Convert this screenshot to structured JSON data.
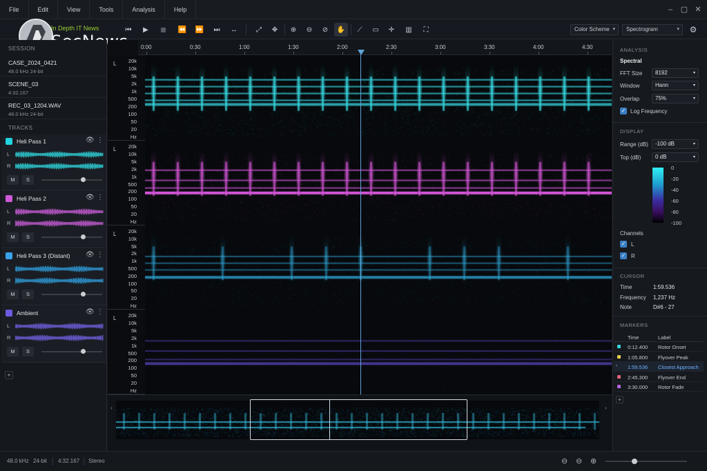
{
  "menu": [
    "File",
    "Edit",
    "View",
    "Tools",
    "Analysis",
    "Help"
  ],
  "logo_text": "SecNews",
  "logo_tagline": "In Depth IT News",
  "toolbar": {
    "color_scheme": "Color Scheme",
    "view_mode": "Spectrogram"
  },
  "session": {
    "header": "SESSION",
    "items": [
      {
        "title": "CASE_2024_0421",
        "sub": "48.0 kHz  24-bit"
      },
      {
        "title": "SCENE_03",
        "sub": "4:32.167"
      },
      {
        "title": "REC_03_1204.WAV",
        "sub": "48.0 kHz  24-bit"
      }
    ]
  },
  "tracks": {
    "header": "TRACKS",
    "items": [
      {
        "name": "Heli Pass 1",
        "color": "#22d3e0",
        "wave": "#2fd0d8",
        "l": "L",
        "r": "R",
        "m": "M",
        "s": "S",
        "level": 0.68
      },
      {
        "name": "Heli Pass 2",
        "color": "#d058d8",
        "wave": "#c45ad2",
        "l": "L",
        "r": "R",
        "m": "M",
        "s": "S",
        "level": 0.68
      },
      {
        "name": "Heli Pass 3 (Distant)",
        "color": "#3aa3e8",
        "wave": "#2f9ad8",
        "l": "L",
        "r": "R",
        "m": "M",
        "s": "S",
        "level": 0.68
      },
      {
        "name": "Ambient",
        "color": "#6a5ce0",
        "wave": "#6d5fdc",
        "l": "L",
        "r": "R",
        "m": "M",
        "s": "S",
        "level": 0.68
      }
    ],
    "add": "+"
  },
  "ruler": [
    "0:00",
    "0:30",
    "1:00",
    "1:30",
    "2:00",
    "2:30",
    "3:00",
    "3:30",
    "4:00",
    "4:30"
  ],
  "freq_labels": [
    "20k",
    "10k",
    "5k",
    "2k",
    "1k",
    "500",
    "200",
    "100",
    "50",
    "20",
    "Hz"
  ],
  "lanes": [
    {
      "channel": "L",
      "color": "#39e3ec",
      "bands": [
        0.28,
        0.36,
        0.44,
        0.52,
        0.56
      ],
      "pulses": true,
      "strength": 1.0
    },
    {
      "channel": "L",
      "color": "#e25be6",
      "bands": [
        0.34,
        0.46,
        0.55,
        0.6
      ],
      "pulses": true,
      "strength": 0.9
    },
    {
      "channel": "L",
      "color": "#34b8ee",
      "bands": [
        0.36,
        0.44,
        0.52,
        0.6
      ],
      "pulses": true,
      "strength": 0.6
    },
    {
      "channel": "L",
      "color": "#6a56e6",
      "bands": [
        0.36,
        0.48,
        0.58,
        0.62
      ],
      "pulses": false,
      "strength": 0.5
    }
  ],
  "analysis": {
    "header": "ANALYSIS",
    "mode": "Spectral",
    "fft_label": "FFT Size",
    "fft_value": "8192",
    "window_label": "Window",
    "window_value": "Hann",
    "overlap_label": "Overlap",
    "overlap_value": "75%",
    "logfreq_label": "Log Frequency"
  },
  "display": {
    "header": "DISPLAY",
    "range_label": "Range (dB)",
    "range_value": "-100 dB",
    "top_label": "Top (dB)",
    "top_value": "0 dB",
    "scale": [
      "0",
      "-20",
      "-40",
      "-60",
      "-80",
      "-100"
    ],
    "channels_label": "Channels",
    "ch_l": "L",
    "ch_r": "R"
  },
  "cursor": {
    "header": "CURSOR",
    "time_label": "Time",
    "time_value": "1:59.536",
    "freq_label": "Frequency",
    "freq_value": "1,237 Hz",
    "note_label": "Note",
    "note_value": "D#6 - 27"
  },
  "markers": {
    "header": "MARKERS",
    "col_time": "Time",
    "col_label": "Label",
    "rows": [
      {
        "time": "0:12.400",
        "label": "Rotor Onset",
        "color": "#39d3e0"
      },
      {
        "time": "1:05.800",
        "label": "Flyover Peak",
        "color": "#e6d24a"
      },
      {
        "time": "1:59.536",
        "label": "Closest Approach",
        "color": "#4aa3ff",
        "active": true
      },
      {
        "time": "2:45.300",
        "label": "Flyover End",
        "color": "#e2637a"
      },
      {
        "time": "3:30.000",
        "label": "Rotor Fade",
        "color": "#b466e0"
      }
    ],
    "add": "+"
  },
  "status": {
    "rate": "48.0 kHz",
    "depth": "24-bit",
    "duration": "4:32.167",
    "channels": "Stereo"
  }
}
